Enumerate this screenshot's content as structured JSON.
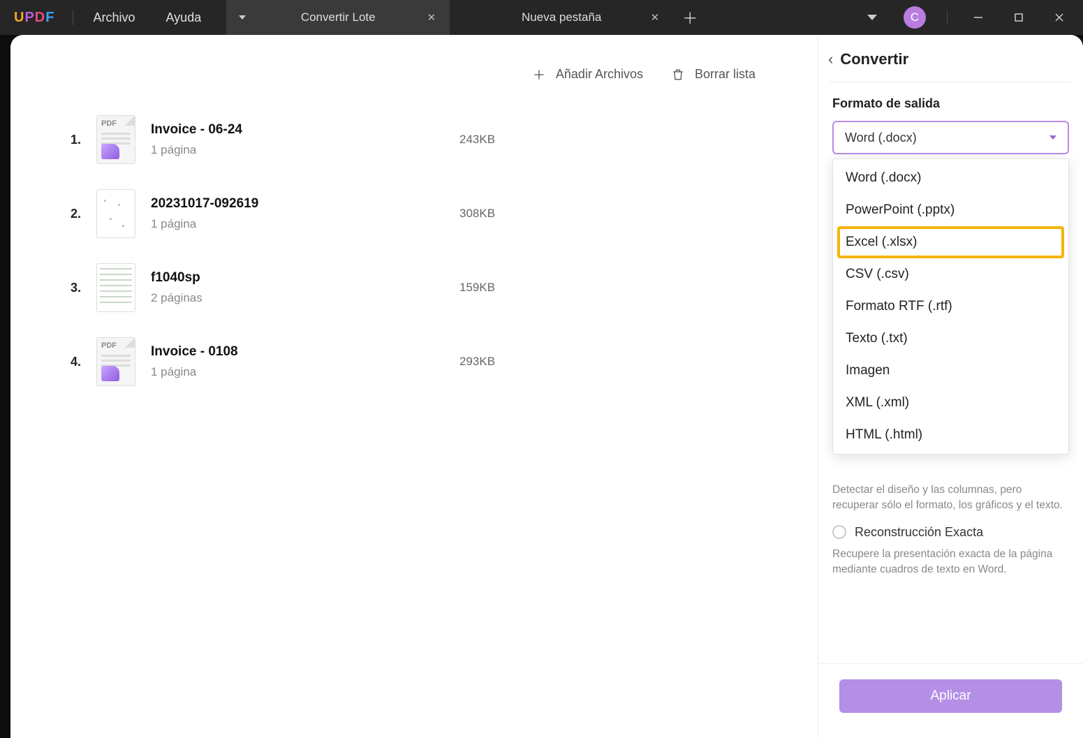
{
  "brand": {
    "u": "U",
    "p": "P",
    "d": "D",
    "f": "F"
  },
  "menu": {
    "archivo": "Archivo",
    "ayuda": "Ayuda"
  },
  "tabs": {
    "active": "Convertir Lote",
    "inactive": "Nueva pestaña"
  },
  "avatar": "C",
  "actions": {
    "add": "Añadir Archivos",
    "clear": "Borrar lista"
  },
  "files": [
    {
      "num": "1.",
      "name": "Invoice - 06-24",
      "pages": "1 página",
      "size": "243KB",
      "thumb": "pdf"
    },
    {
      "num": "2.",
      "name": "20231017-092619",
      "pages": "1 página",
      "size": "308KB",
      "thumb": "sparse"
    },
    {
      "num": "3.",
      "name": "f1040sp",
      "pages": "2 páginas",
      "size": "159KB",
      "thumb": "grid"
    },
    {
      "num": "4.",
      "name": "Invoice - 0108",
      "pages": "1 página",
      "size": "293KB",
      "thumb": "pdf"
    }
  ],
  "panel": {
    "title": "Convertir",
    "formatLabel": "Formato de salida",
    "selected": "Word (.docx)",
    "options": [
      "Word (.docx)",
      "PowerPoint (.pptx)",
      "Excel (.xlsx)",
      "CSV (.csv)",
      "Formato RTF (.rtf)",
      "Texto (.txt)",
      "Imagen",
      "XML (.xml)",
      "HTML (.html)"
    ],
    "highlightIndex": 2,
    "desc1": "Detectar el diseño y las columnas, pero recuperar sólo el formato, los gráficos y el texto.",
    "radioLabel": "Reconstrucción Exacta",
    "desc2": "Recupere la presentación exacta de la página mediante cuadros de texto en Word.",
    "apply": "Aplicar"
  }
}
